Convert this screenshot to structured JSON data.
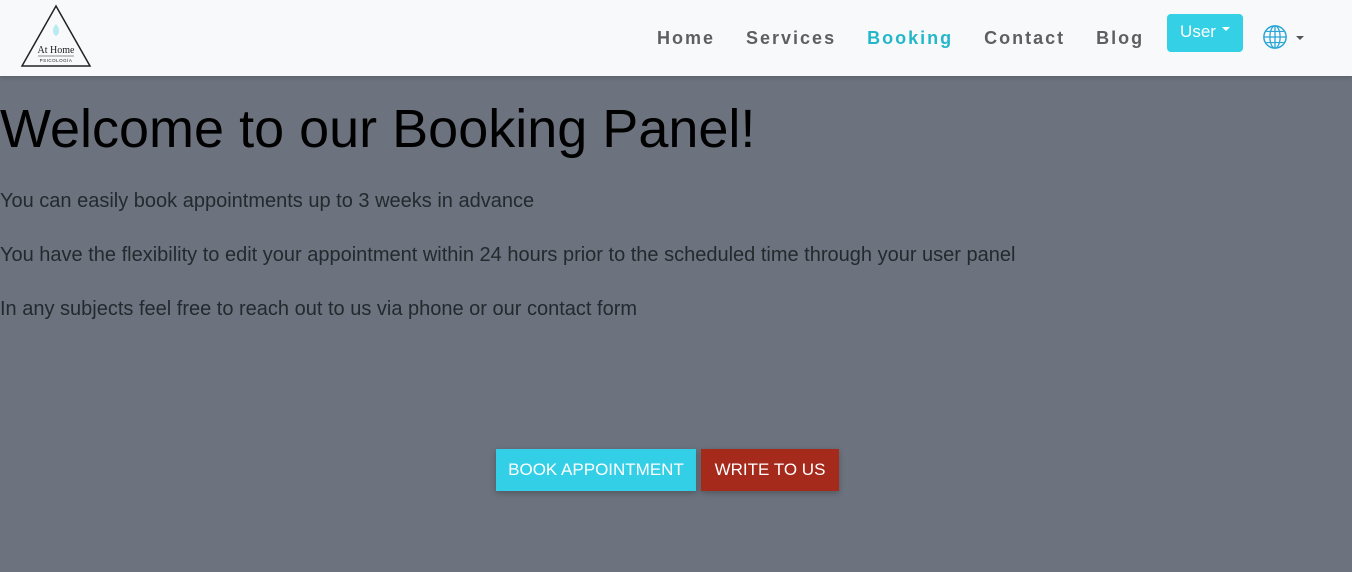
{
  "logo": {
    "text": "At Home",
    "subtext": "PSICOLOGÍA"
  },
  "nav": {
    "links": [
      {
        "label": "Home",
        "active": false
      },
      {
        "label": "Services",
        "active": false
      },
      {
        "label": "Booking",
        "active": true
      },
      {
        "label": "Contact",
        "active": false
      },
      {
        "label": "Blog",
        "active": false
      }
    ],
    "user_label": "User",
    "language_icon": "globe-icon"
  },
  "hero": {
    "title": "Welcome to our Booking Panel!",
    "lines": [
      "You can easily book appointments up to 3 weeks in advance",
      "You have the flexibility to edit your appointment within 24 hours prior to the scheduled time through your user panel",
      "In any subjects feel free to reach out to us via phone or our contact form"
    ],
    "book_button": "BOOK APPOINTMENT",
    "write_button": "WRITE TO US"
  },
  "colors": {
    "accent": "#33d0e6",
    "active_link": "#23b7c9",
    "danger": "#a52a1c",
    "overlay": "#6c737e"
  }
}
